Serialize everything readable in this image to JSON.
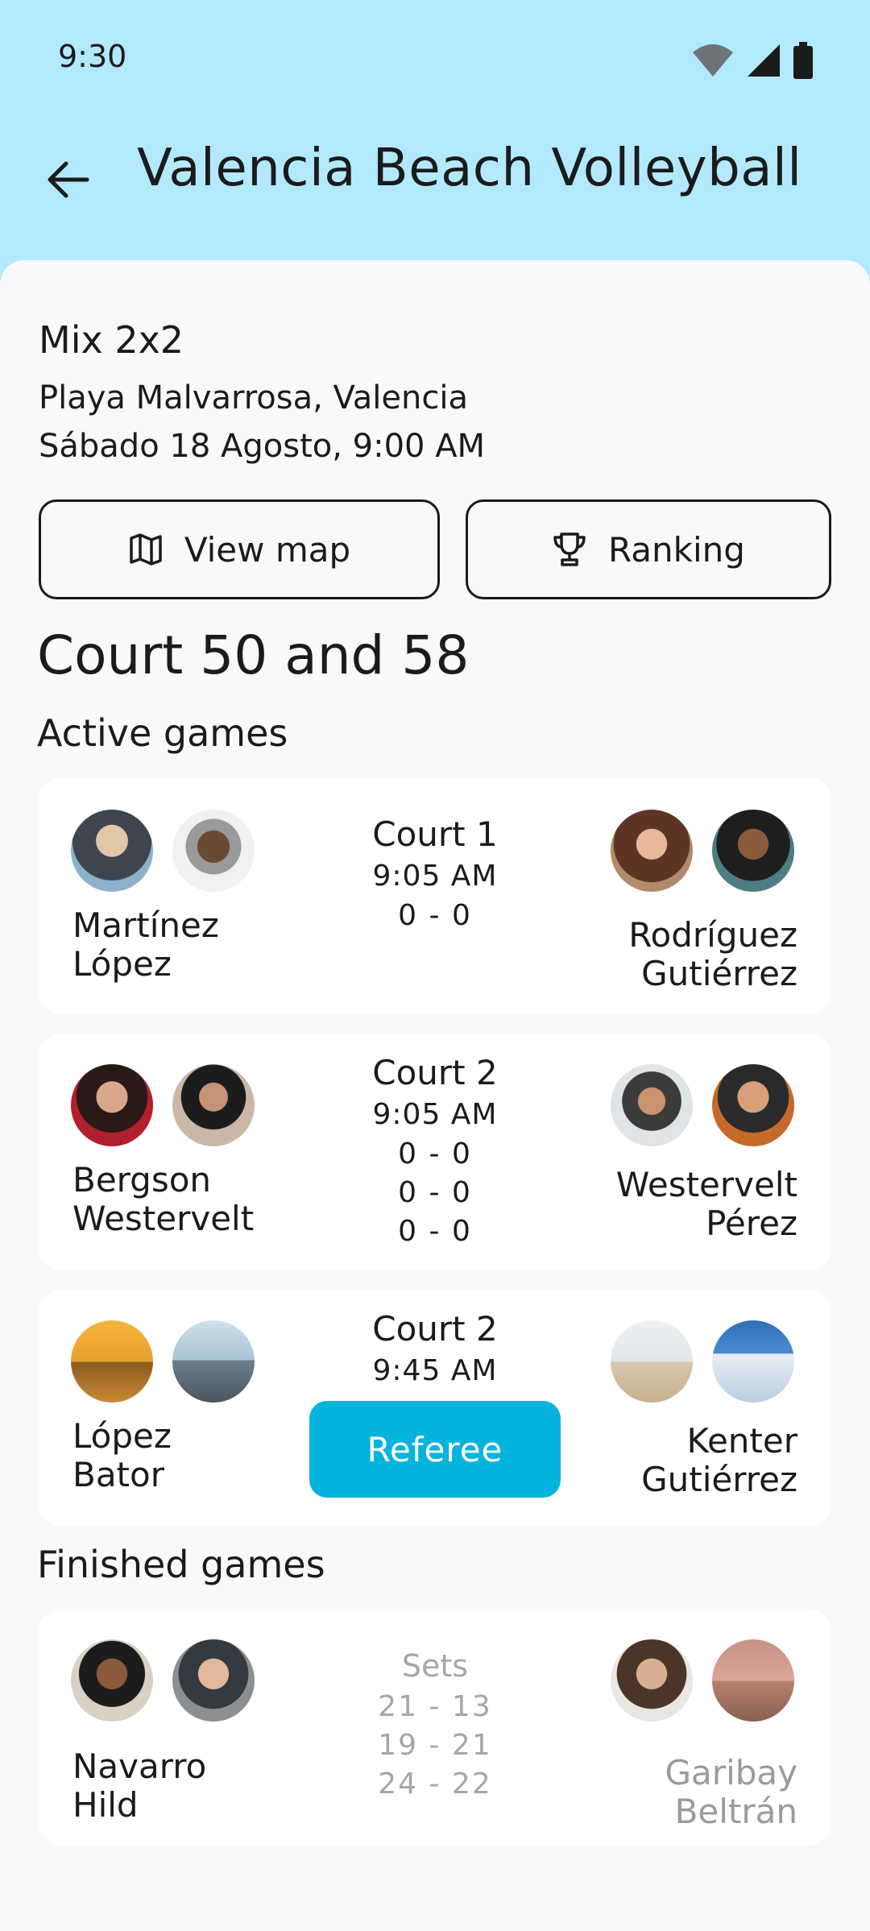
{
  "status": {
    "time": "9:30",
    "icons": [
      "wifi-icon",
      "signal-icon",
      "battery-icon"
    ]
  },
  "appbar": {
    "title": "Valencia Beach Volleyball",
    "back_icon": "arrow-left-icon"
  },
  "event": {
    "name": "Mix 2x2",
    "place": "Playa Malvarrosa, Valencia",
    "date": "Sábado 18 Agosto, 9:00 AM"
  },
  "actions": {
    "map_label": "View map",
    "map_icon": "map-icon",
    "ranking_label": "Ranking",
    "ranking_icon": "trophy-icon"
  },
  "court_heading": "Court 50 and 58",
  "active_title": "Active games",
  "finished_title": "Finished games",
  "active_games": [
    {
      "team_left": [
        "Martínez",
        "López"
      ],
      "team_right": [
        "Rodríguez",
        "Gutiérrez"
      ],
      "court": "Court 1",
      "time": "9:05 AM",
      "scores": [
        "0 - 0"
      ]
    },
    {
      "team_left": [
        "Bergson",
        "Westervelt"
      ],
      "team_right": [
        "Westervelt",
        "Pérez"
      ],
      "court": "Court 2",
      "time": "9:05 AM",
      "scores": [
        "0 - 0",
        "0 - 0",
        "0 - 0"
      ]
    },
    {
      "team_left": [
        "López",
        "Bator"
      ],
      "team_right": [
        "Kenter",
        "Gutiérrez"
      ],
      "court": "Court 2",
      "time": "9:45 AM",
      "action": "Referee"
    }
  ],
  "finished_games": [
    {
      "team_left": [
        "Navarro",
        "Hild"
      ],
      "team_right": [
        "Garibay",
        "Beltrán"
      ],
      "sets_label": "Sets",
      "sets": [
        "21 - 13",
        "19 - 21",
        "24 - 22"
      ]
    }
  ],
  "colors": {
    "header_bg": "#b3e9fd",
    "sheet_bg": "#f7f9fb",
    "accent": "#05b4dc"
  }
}
